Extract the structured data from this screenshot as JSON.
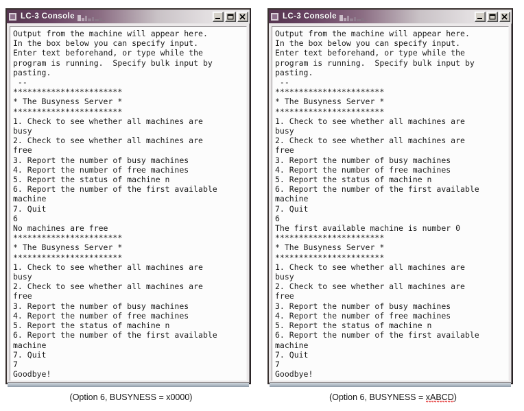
{
  "window": {
    "title": "LC-3 Console",
    "icon": "app-square-icon",
    "buttons": {
      "minimize": "Minimize",
      "maximize": "Maximize",
      "close": "Close"
    },
    "accent_color": "#55354f",
    "text_color": "#1a1a1a",
    "console_background": "#fcfcfc"
  },
  "panels": [
    {
      "id": "left",
      "caption": "(Option 6, BUSYNESS = x0000)",
      "caption_plain": "(Option 6, BUSYNESS = ",
      "caption_misspelled": "x0000",
      "caption_tail": ")",
      "misspelled_flag": false,
      "console_text": "Output from the machine will appear here.\nIn the box below you can specify input.\nEnter text beforehand, or type while the\nprogram is running.  Specify bulk input by\npasting.\n --\n***********************\n* The Busyness Server *\n***********************\n1. Check to see whether all machines are\nbusy\n2. Check to see whether all machines are\nfree\n3. Report the number of busy machines\n4. Report the number of free machines\n5. Report the status of machine n\n6. Report the number of the first available\nmachine\n7. Quit\n6\nNo machines are free\n***********************\n* The Busyness Server *\n***********************\n1. Check to see whether all machines are\nbusy\n2. Check to see whether all machines are\nfree\n3. Report the number of busy machines\n4. Report the number of free machines\n5. Report the status of machine n\n6. Report the number of the first available\nmachine\n7. Quit\n7\nGoodbye!"
    },
    {
      "id": "right",
      "caption": "(Option 6, BUSYNESS = xABCD)",
      "caption_plain": "(Option 6, BUSYNESS = ",
      "caption_misspelled": "xABCD",
      "caption_tail": ")",
      "misspelled_flag": true,
      "console_text": "Output from the machine will appear here.\nIn the box below you can specify input.\nEnter text beforehand, or type while the\nprogram is running.  Specify bulk input by\npasting.\n --\n***********************\n* The Busyness Server *\n***********************\n1. Check to see whether all machines are\nbusy\n2. Check to see whether all machines are\nfree\n3. Report the number of busy machines\n4. Report the number of free machines\n5. Report the status of machine n\n6. Report the number of the first available\nmachine\n7. Quit\n6\nThe first available machine is number 0\n***********************\n* The Busyness Server *\n***********************\n1. Check to see whether all machines are\nbusy\n2. Check to see whether all machines are\nfree\n3. Report the number of busy machines\n4. Report the number of free machines\n5. Report the status of machine n\n6. Report the number of the first available\nmachine\n7. Quit\n7\nGoodbye!"
    }
  ]
}
